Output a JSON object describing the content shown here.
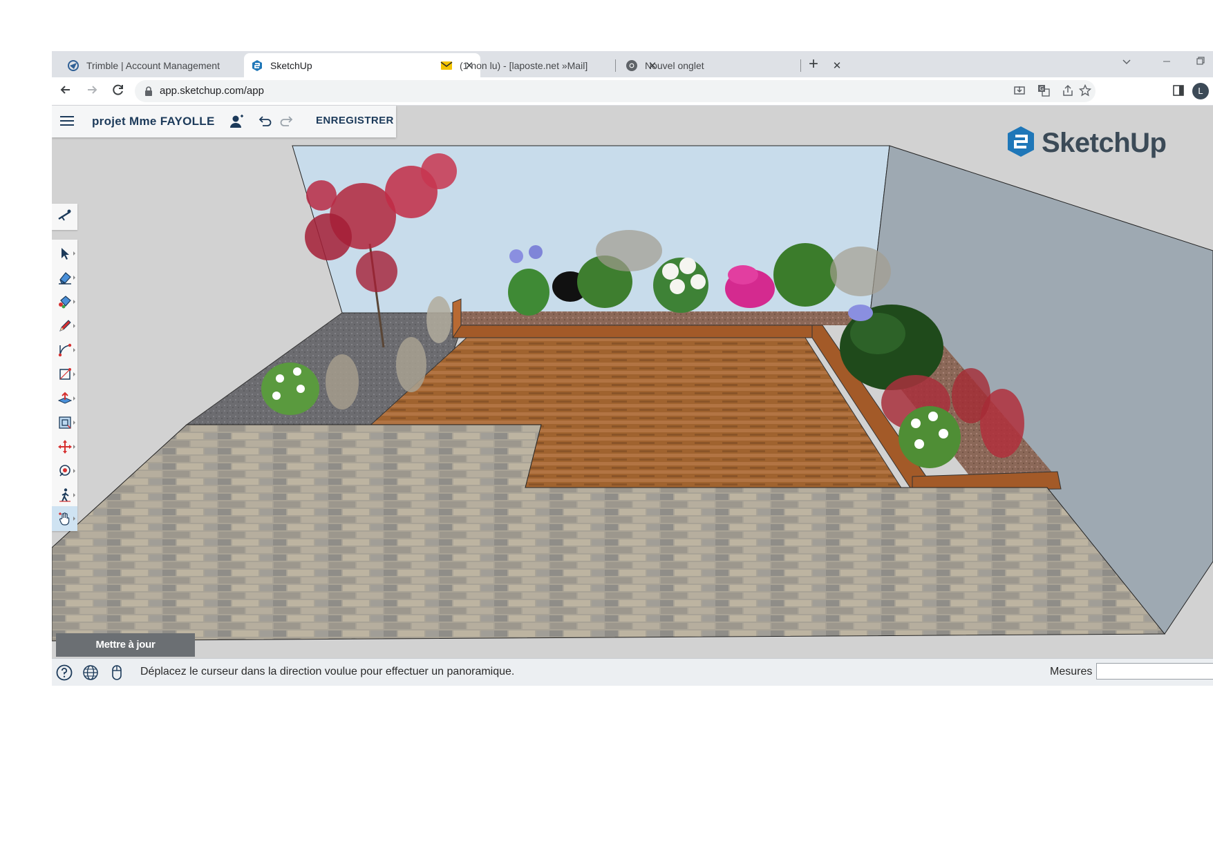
{
  "browser": {
    "tabs": [
      {
        "title": "Trimble | Account Management",
        "icon": "trimble-icon",
        "active": false
      },
      {
        "title": "SketchUp",
        "icon": "sketchup-icon",
        "active": true
      },
      {
        "title": "(1 non lu) - [laposte.net »Mail]",
        "icon": "mail-icon",
        "active": false
      },
      {
        "title": "Nouvel onglet",
        "icon": "chrome-icon",
        "active": false
      }
    ],
    "new_tab": "+",
    "close_glyph": "✕",
    "url": "app.sketchup.com/app",
    "profile_initial": "L",
    "window_controls": [
      "chevron-down-icon",
      "minimize-icon",
      "restore-icon"
    ]
  },
  "app": {
    "project_name": "projet Mme FAYOLLE",
    "save_label": "ENREGISTRER",
    "logo_text": "SketchUp",
    "update_button": "Mettre à jour",
    "status_message": "Déplacez le curseur dans la direction voulue pour effectuer un panoramique.",
    "measures_label": "Mesures",
    "measures_value": "",
    "toolbar_tools": [
      {
        "name": "select-tool",
        "icon": "arrow-icon"
      },
      {
        "name": "eraser-tool",
        "icon": "eraser-icon"
      },
      {
        "name": "paint-bucket-tool",
        "icon": "paint-bucket-icon"
      },
      {
        "name": "pencil-tool",
        "icon": "pencil-icon"
      },
      {
        "name": "arc-tool",
        "icon": "arc-icon"
      },
      {
        "name": "rectangle-tool",
        "icon": "rectangle-icon"
      },
      {
        "name": "push-pull-tool",
        "icon": "push-pull-icon"
      },
      {
        "name": "offset-tool",
        "icon": "offset-icon"
      },
      {
        "name": "move-tool",
        "icon": "move-icon"
      },
      {
        "name": "orbit-tool",
        "icon": "orbit-icon"
      },
      {
        "name": "walk-tool",
        "icon": "walk-icon"
      },
      {
        "name": "pan-tool",
        "icon": "pan-hand-icon",
        "active": true
      }
    ],
    "colors": {
      "accent": "#1c3a5a",
      "sketchup_blue": "#1f77b8",
      "sky": "#c8dceb",
      "wall": "#9aa7b1",
      "deck": "#9d6131",
      "paving": "#a8a297"
    }
  }
}
